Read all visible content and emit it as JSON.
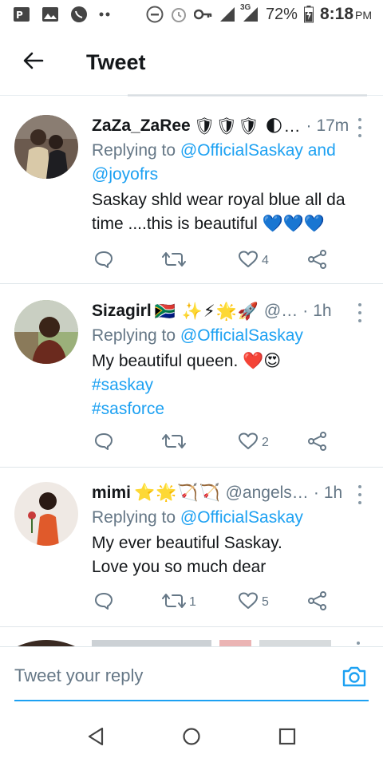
{
  "status_bar": {
    "network": "3G",
    "battery": "72%",
    "time": "8:18",
    "ampm": "PM"
  },
  "header": {
    "title": "Tweet"
  },
  "tweets": [
    {
      "name": "ZaZa_ZaRee",
      "name_emoji": "🛡🛡🛡 🌓…",
      "handle": "",
      "time": "17m",
      "replying_prefix": "Replying to ",
      "replying_to": "@OfficialSaskay and @joyofrs",
      "text": "Saskay shld wear royal blue all da time ....this is beautiful 💙💙💙",
      "hashtags": [],
      "reply_count": "",
      "retweet_count": "",
      "like_count": "4"
    },
    {
      "name": "Sizagirl",
      "name_emoji": "🇿🇦 ✨⚡🌟🚀",
      "handle": "@…",
      "time": "1h",
      "replying_prefix": "Replying to ",
      "replying_to": "@OfficialSaskay",
      "text": "My beautiful queen. ❤️😍",
      "hashtags": [
        "#saskay",
        "#sasforce"
      ],
      "reply_count": "",
      "retweet_count": "",
      "like_count": "2"
    },
    {
      "name": "mimi",
      "name_emoji": "⭐🌟🏹🏹",
      "handle": "@angels…",
      "time": "1h",
      "replying_prefix": "Replying to ",
      "replying_to": "@OfficialSaskay",
      "text_line1": "My ever beautiful Saskay.",
      "text_line2": "Love you so much dear",
      "hashtags": [],
      "reply_count": "",
      "retweet_count": "1",
      "like_count": "5"
    }
  ],
  "reply_bar": {
    "placeholder": "Tweet your reply"
  },
  "colors": {
    "accent": "#1da1f2",
    "secondary_text": "#657786",
    "divider": "#e6ecf0"
  },
  "icons": {
    "back": "arrow-left-icon",
    "reply": "chat-bubble-icon",
    "retweet": "retweet-icon",
    "like": "heart-icon",
    "share": "share-icon",
    "camera": "camera-icon"
  }
}
